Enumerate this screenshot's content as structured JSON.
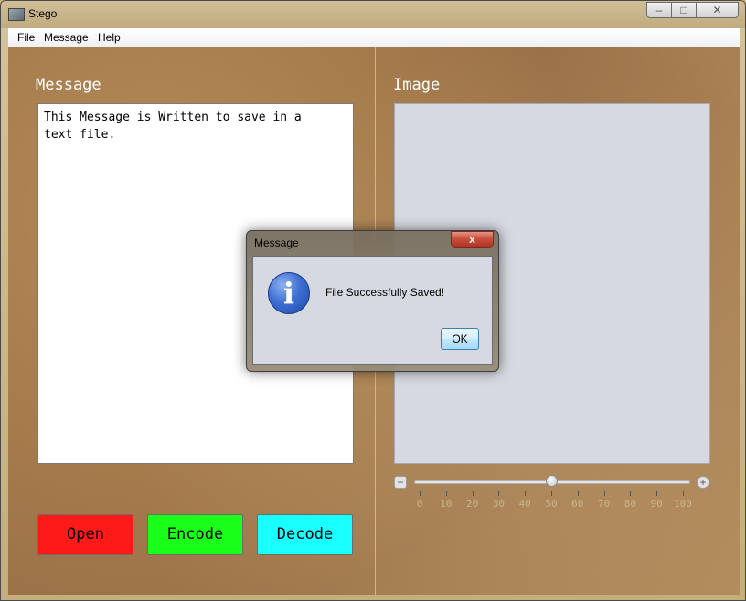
{
  "window": {
    "title": "Stego"
  },
  "menu": [
    "File",
    "Message",
    "Help"
  ],
  "panels": {
    "message_label": "Message",
    "message_text": "This Message is Written to save in a\ntext file.",
    "image_label": "Image"
  },
  "buttons": {
    "open": "Open",
    "encode": "Encode",
    "decode": "Decode"
  },
  "button_colors": {
    "open": "#ff1a1a",
    "encode": "#19ff19",
    "decode": "#19ffff"
  },
  "slider": {
    "value": 50,
    "min": 0,
    "max": 100,
    "minus_icon": "minus-icon",
    "plus_icon": "plus-icon",
    "tick_labels": [
      "0",
      "10",
      "20",
      "30",
      "40",
      "50",
      "60",
      "70",
      "80",
      "90",
      "100"
    ]
  },
  "dialog": {
    "title": "Message",
    "close_glyph": "x",
    "icon": "info-icon",
    "icon_glyph": "i",
    "message": "File Successfully Saved!",
    "ok_label": "OK"
  }
}
